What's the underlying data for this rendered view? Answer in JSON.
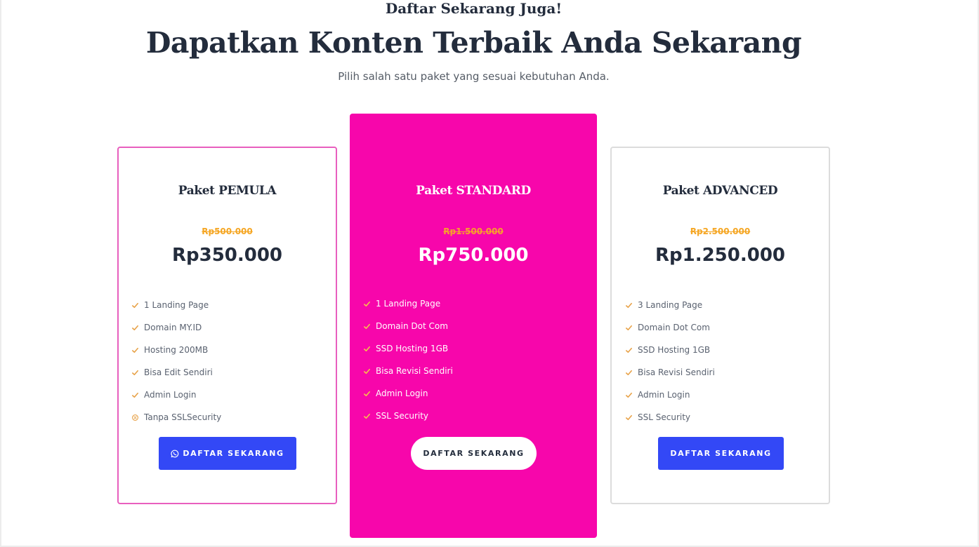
{
  "header": {
    "kicker": "Daftar Sekarang Juga!",
    "headline": "Dapatkan Konten Terbaik Anda Sekarang",
    "subtitle": "Pilih salah satu paket yang sesuai kebutuhan Anda."
  },
  "colors": {
    "accent_pink": "#f706ab",
    "border_pink": "#e85fbe",
    "button_blue": "#3348f6",
    "strike_orange": "#f5a623",
    "check_orange": "#e8a34a"
  },
  "plans": [
    {
      "name": "Paket PEMULA",
      "old_price": "Rp500.000",
      "price": "Rp350.000",
      "features": [
        {
          "label": "1 Landing Page",
          "icon": "check-icon"
        },
        {
          "label": "Domain MY.ID",
          "icon": "check-icon"
        },
        {
          "label": "Hosting 200MB",
          "icon": "check-icon"
        },
        {
          "label": "Bisa Edit Sendiri",
          "icon": "check-icon"
        },
        {
          "label": "Admin Login",
          "icon": "check-icon"
        },
        {
          "label": "Tanpa SSLSecurity",
          "icon": "x-circle-icon"
        }
      ],
      "button": {
        "label": "DAFTAR SEKARANG",
        "icon": "whatsapp-icon"
      }
    },
    {
      "name": "Paket STANDARD",
      "old_price": "Rp1.500.000",
      "price": "Rp750.000",
      "features": [
        {
          "label": "1 Landing Page",
          "icon": "check-icon"
        },
        {
          "label": "Domain Dot Com",
          "icon": "check-icon"
        },
        {
          "label": "SSD Hosting 1GB",
          "icon": "check-icon"
        },
        {
          "label": "Bisa Revisi Sendiri",
          "icon": "check-icon"
        },
        {
          "label": "Admin Login",
          "icon": "check-icon"
        },
        {
          "label": "SSL Security",
          "icon": "check-icon"
        }
      ],
      "button": {
        "label": "DAFTAR SEKARANG"
      }
    },
    {
      "name": "Paket ADVANCED",
      "old_price": "Rp2.500.000",
      "price": "Rp1.250.000",
      "features": [
        {
          "label": "3 Landing Page",
          "icon": "check-icon"
        },
        {
          "label": "Domain Dot Com",
          "icon": "check-icon"
        },
        {
          "label": "SSD Hosting 1GB",
          "icon": "check-icon"
        },
        {
          "label": "Bisa Revisi Sendiri",
          "icon": "check-icon"
        },
        {
          "label": "Admin Login",
          "icon": "check-icon"
        },
        {
          "label": "SSL Security",
          "icon": "check-icon"
        }
      ],
      "button": {
        "label": "DAFTAR SEKARANG"
      }
    }
  ]
}
